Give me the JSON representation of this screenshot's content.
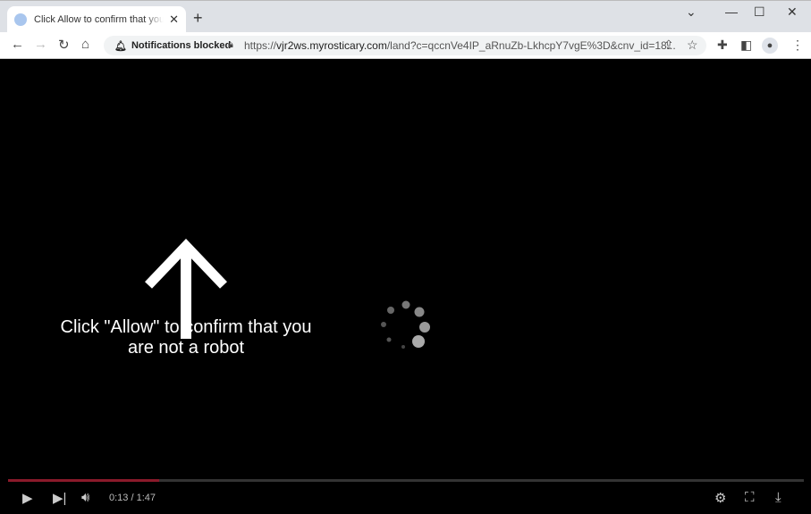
{
  "tab": {
    "title": "Click Allow to confirm that you are not a robot",
    "favicon": "bell-shield-icon"
  },
  "toolbar": {
    "notifications_chip": "Notifications blocked",
    "url_scheme": "https://",
    "url_host": "vjr2ws.myrosticary.com",
    "url_rest": "/land?c=qccnVe4IP_aRnuZb-LkhcpY7vgE%3D&cnv_id=18..."
  },
  "page": {
    "message": "Click \"Allow\" to confirm that you are not a robot"
  },
  "player": {
    "time": "0:13 / 1:47",
    "progress_fraction": 0.19,
    "progress_color": "#8b1a2b"
  }
}
